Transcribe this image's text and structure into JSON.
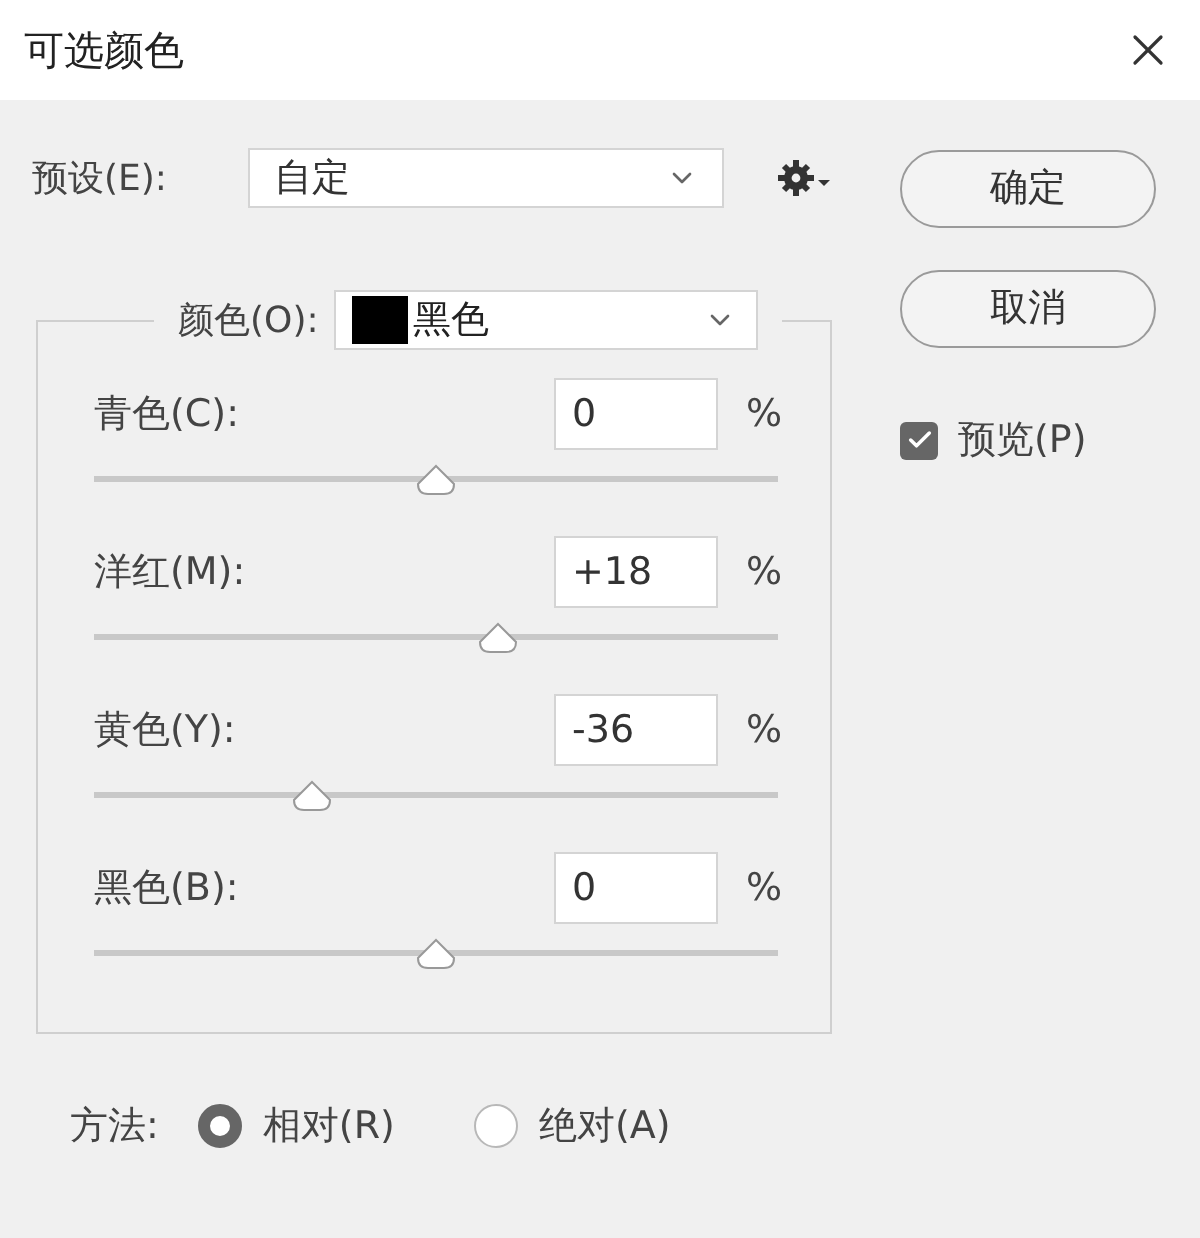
{
  "window": {
    "title": "可选颜色"
  },
  "preset": {
    "label": "预设(E):",
    "value": "自定"
  },
  "buttons": [
    "确定",
    "取消"
  ],
  "preview": {
    "label": "预览(P)",
    "checked": true
  },
  "colors": {
    "label": "颜色(O):",
    "value": "黑色",
    "color": "#000000"
  },
  "channels": [
    {
      "label": "青色(C):",
      "value": "0",
      "unit": "%",
      "level": 0.5
    },
    {
      "label": "洋红(M):",
      "value": "+18",
      "unit": "%",
      "level": 0.59
    },
    {
      "label": "黄色(Y):",
      "value": "-36",
      "unit": "%",
      "level": 0.32
    },
    {
      "label": "黑色(B):",
      "value": "0",
      "unit": "%",
      "level": 0.5
    }
  ],
  "method": {
    "label": "方法:",
    "options": [
      {
        "label": "相对(R)",
        "selected": true
      },
      {
        "label": "绝对(A)",
        "selected": false
      }
    ]
  }
}
